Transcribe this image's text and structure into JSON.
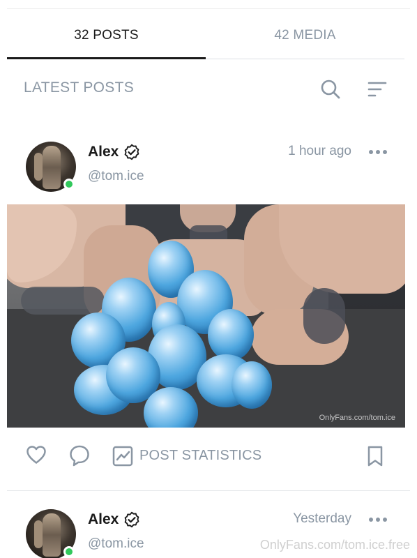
{
  "tabs": [
    {
      "label": "32 POSTS",
      "active": true
    },
    {
      "label": "42 MEDIA",
      "active": false
    }
  ],
  "section": {
    "title": "LATEST POSTS",
    "search_icon": "search-icon",
    "sort_icon": "sort-lines-icon"
  },
  "posts": [
    {
      "author": "Alex",
      "handle": "@tom.ice",
      "time": "1 hour ago",
      "verified_icon": "verified-badge-icon",
      "online": true,
      "media_watermark": "OnlyFans.com/tom.ice",
      "actions": {
        "like_icon": "heart-icon",
        "comment_icon": "comment-icon",
        "stats_icon": "stats-chart-icon",
        "stats_label": "POST STATISTICS",
        "bookmark_icon": "bookmark-icon"
      }
    },
    {
      "author": "Alex",
      "handle": "@tom.ice",
      "time": "Yesterday",
      "verified_icon": "verified-badge-icon",
      "online": true
    }
  ],
  "page_watermark": "OnlyFans.com/tom.ice.free",
  "colors": {
    "text_primary": "#1a1a1a",
    "text_muted": "#8a96a3",
    "online": "#32c85c",
    "balloon": "#4da6df"
  }
}
